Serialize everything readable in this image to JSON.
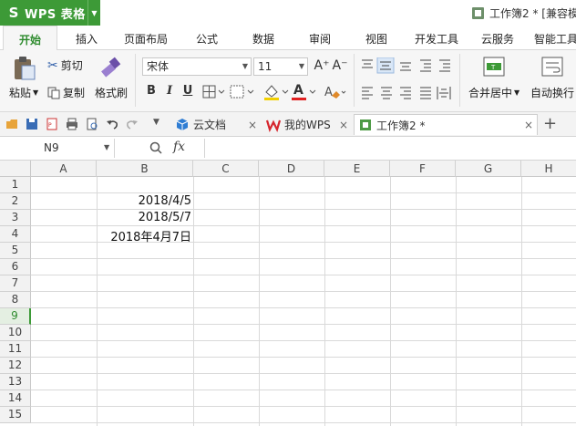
{
  "app": {
    "logo": "S",
    "name": "WPS 表格",
    "doc_title": "工作簿2 * [兼容模"
  },
  "menu": [
    "开始",
    "插入",
    "页面布局",
    "公式",
    "数据",
    "审阅",
    "视图",
    "开发工具",
    "云服务",
    "智能工具"
  ],
  "ribbon": {
    "paste": "粘贴",
    "cut": "剪切",
    "copy": "复制",
    "format_painter": "格式刷",
    "font_name": "宋体",
    "font_size": "11",
    "grow_font": "A⁺",
    "shrink_font": "A⁻",
    "bold": "B",
    "italic": "I",
    "underline": "U",
    "font_color_letter": "A",
    "merge_center": "合并居中",
    "wrap_text": "自动换行"
  },
  "doc_tabs": [
    {
      "label": "云文档"
    },
    {
      "label": "我的WPS"
    },
    {
      "label": "工作簿2 *"
    }
  ],
  "formula_bar": {
    "name_box": "N9",
    "fx": "fx",
    "value": ""
  },
  "grid": {
    "columns": [
      "A",
      "B",
      "C",
      "D",
      "E",
      "F",
      "G",
      "H"
    ],
    "rows": [
      "1",
      "2",
      "3",
      "4",
      "5",
      "6",
      "7",
      "8",
      "9",
      "10",
      "11",
      "12",
      "13",
      "14",
      "15"
    ],
    "selected_row": "9",
    "cells": [
      {
        "ref": "B2",
        "value": "2018/4/5"
      },
      {
        "ref": "B3",
        "value": "2018/5/7"
      },
      {
        "ref": "B4",
        "value": "2018年4月7日"
      }
    ]
  },
  "colors": {
    "accent_green": "#3d9a37",
    "ribbon_bg": "#f6f6f6",
    "grid_line": "#d4d4d4"
  }
}
